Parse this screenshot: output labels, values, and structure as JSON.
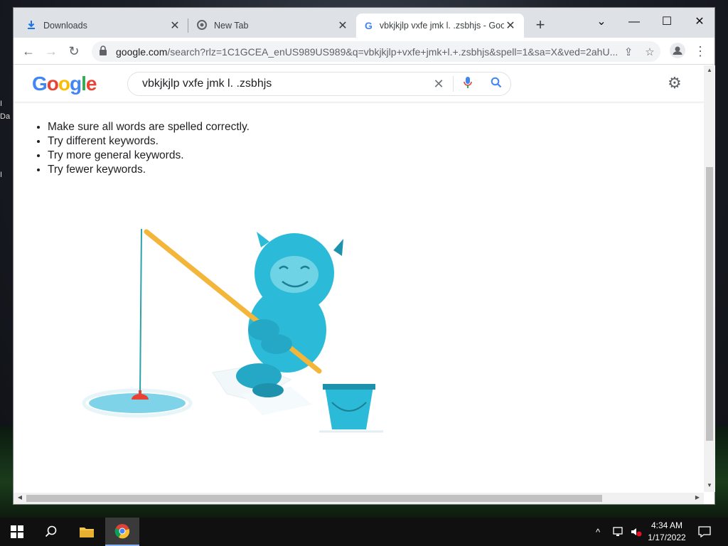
{
  "desktop": {
    "labels": [
      "I",
      "Da",
      "I"
    ]
  },
  "browser": {
    "tabs": [
      {
        "title": "Downloads",
        "icon": "download-icon",
        "active": false
      },
      {
        "title": "New Tab",
        "icon": "chrome-icon",
        "active": false
      },
      {
        "title": "vbkjkjlp vxfe jmk l. .zsbhjs - Goog",
        "icon": "google-icon",
        "active": true
      }
    ],
    "url_domain": "google.com",
    "url_rest": "/search?rlz=1C1GCEA_enUS989US989&q=vbkjkjlp+vxfe+jmk+l.+.zsbhjs&spell=1&sa=X&ved=2ahU..."
  },
  "google": {
    "logo_text": "Google",
    "search_query": "vbkjkjlp vxfe jmk l. .zsbhjs",
    "tips": [
      "Make sure all words are spelled correctly.",
      "Try different keywords.",
      "Try more general keywords.",
      "Try fewer keywords."
    ]
  },
  "taskbar": {
    "time": "4:34 AM",
    "date": "1/17/2022"
  },
  "colors": {
    "yeti": "#2bbbd8",
    "rod": "#f4b63a",
    "ice": "#7fd3e8"
  }
}
